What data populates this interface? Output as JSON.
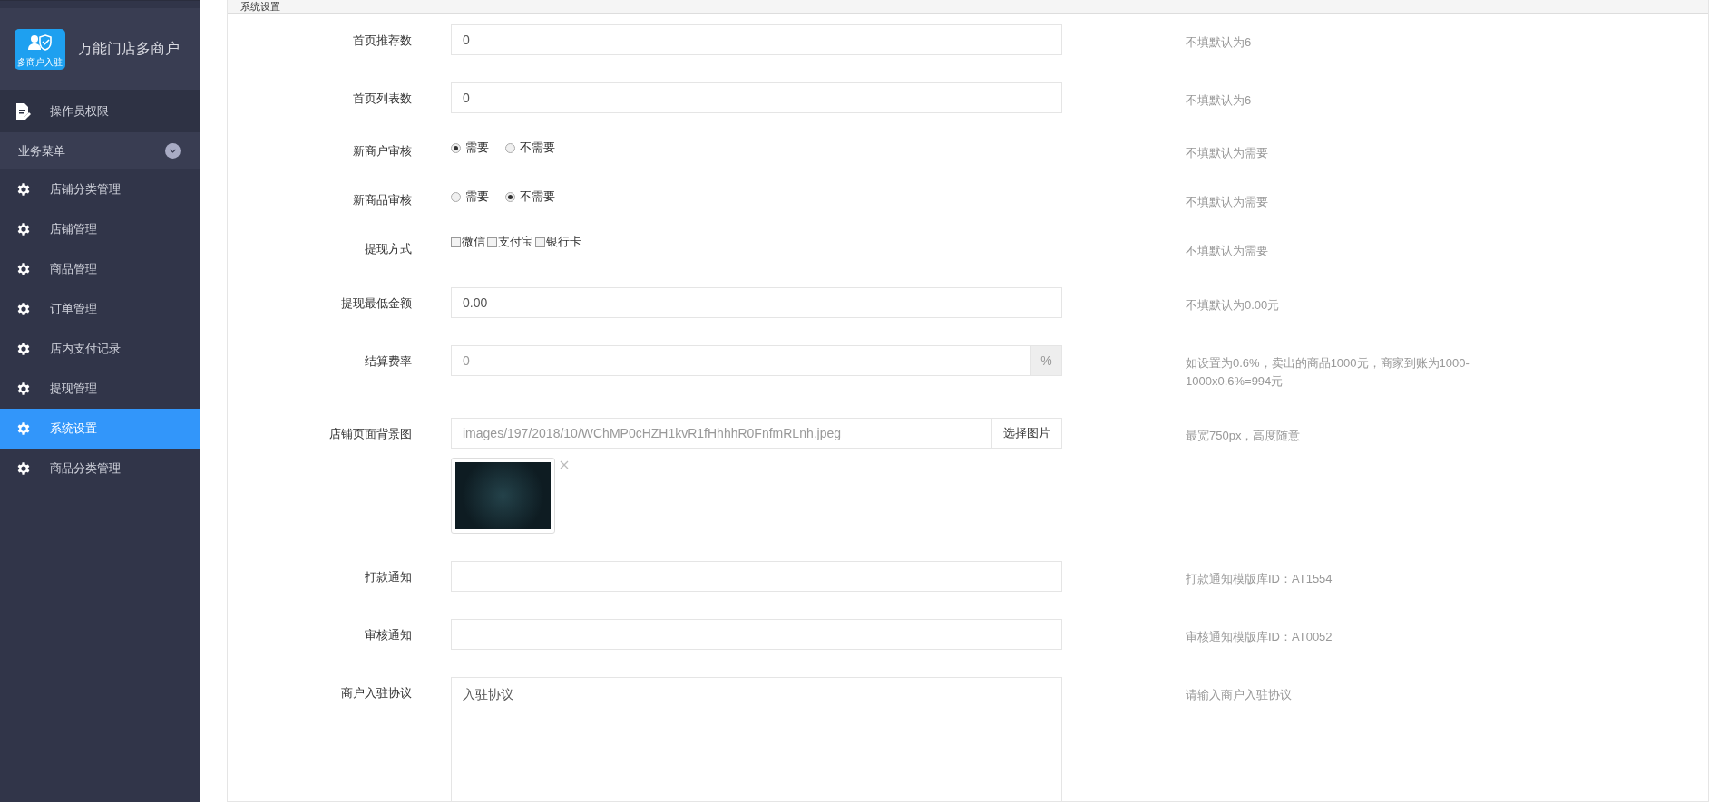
{
  "sidebar": {
    "logo_caption": "多商户入驻",
    "brand": "万能门店多商户",
    "top_items": [
      {
        "label": "操作员权限",
        "selected": false
      }
    ],
    "group": {
      "label": "业务菜单",
      "expanded": true
    },
    "items": [
      {
        "label": "店铺分类管理",
        "selected": false
      },
      {
        "label": "店铺管理",
        "selected": false
      },
      {
        "label": "商品管理",
        "selected": false
      },
      {
        "label": "订单管理",
        "selected": false
      },
      {
        "label": "店内支付记录",
        "selected": false
      },
      {
        "label": "提现管理",
        "selected": false
      },
      {
        "label": "系统设置",
        "selected": true
      },
      {
        "label": "商品分类管理",
        "selected": false
      }
    ]
  },
  "panel": {
    "title": "系统设置",
    "fields": [
      {
        "kind": "text",
        "label": "首页推荐数",
        "value": "0",
        "hint": "不填默认为6"
      },
      {
        "kind": "text",
        "label": "首页列表数",
        "value": "0",
        "hint": "不填默认为6"
      },
      {
        "kind": "radio",
        "label": "新商户审核",
        "options": [
          {
            "label": "需要",
            "selected": true
          },
          {
            "label": "不需要",
            "selected": false
          }
        ],
        "hint": "不填默认为需要"
      },
      {
        "kind": "radio",
        "label": "新商品审核",
        "options": [
          {
            "label": "需要",
            "selected": false
          },
          {
            "label": "不需要",
            "selected": true
          }
        ],
        "hint": "不填默认为需要"
      },
      {
        "kind": "checkbox",
        "label": "提现方式",
        "options": [
          {
            "label": "微信",
            "checked": false
          },
          {
            "label": "支付宝",
            "checked": false
          },
          {
            "label": "银行卡",
            "checked": false
          }
        ],
        "hint": "不填默认为需要"
      },
      {
        "kind": "text",
        "label": "提现最低金额",
        "value": "0.00",
        "hint": "不填默认为0.00元"
      },
      {
        "kind": "addon",
        "label": "结算费率",
        "value": "0",
        "addon": "%",
        "hint": "如设置为0.6%，卖出的商品1000元，商家到账为1000-1000x0.6%=994元"
      },
      {
        "kind": "image",
        "label": "店铺页面背景图",
        "value": "images/197/2018/10/WChMP0cHZH1kvR1fHhhhR0FnfmRLnh.jpeg",
        "button": "选择图片",
        "hint": "最宽750px，高度随意"
      },
      {
        "kind": "text",
        "label": "打款通知",
        "hint": "打款通知模版库ID：AT1554"
      },
      {
        "kind": "text",
        "label": "审核通知",
        "hint": "审核通知模版库ID：AT0052"
      },
      {
        "kind": "textarea",
        "label": "商户入驻协议",
        "value": "入驻协议",
        "hint": "请输入商户入驻协议"
      }
    ]
  }
}
